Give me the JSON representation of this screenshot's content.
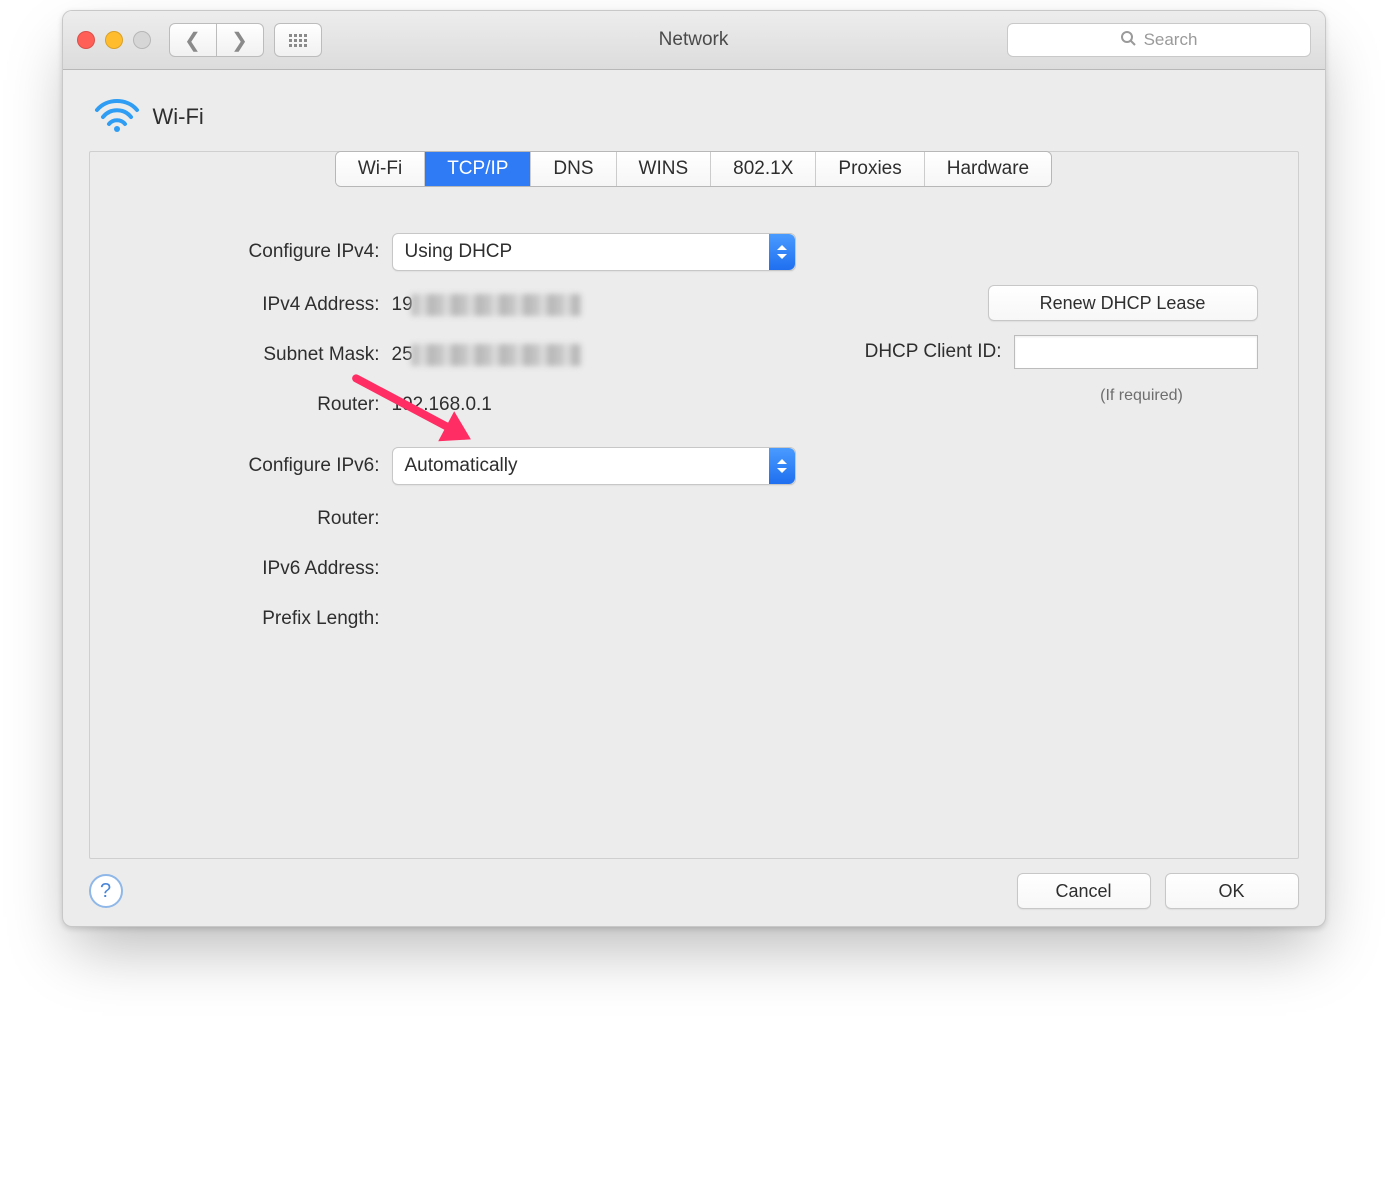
{
  "window": {
    "title": "Network"
  },
  "toolbar": {
    "search_placeholder": "Search"
  },
  "header": {
    "interface_name": "Wi-Fi"
  },
  "tabs": {
    "items": [
      "Wi-Fi",
      "TCP/IP",
      "DNS",
      "WINS",
      "802.1X",
      "Proxies",
      "Hardware"
    ],
    "active_index": 1
  },
  "ipv4": {
    "configure_label": "Configure IPv4:",
    "configure_value": "Using DHCP",
    "address_label": "IPv4 Address:",
    "address_value_visible_prefix": "19",
    "subnet_label": "Subnet Mask:",
    "subnet_value_visible_prefix": "25",
    "router_label": "Router:",
    "router_value": "192.168.0.1"
  },
  "ipv6": {
    "configure_label": "Configure IPv6:",
    "configure_value": "Automatically",
    "router_label": "Router:",
    "router_value": "",
    "address_label": "IPv6 Address:",
    "address_value": "",
    "prefix_label": "Prefix Length:",
    "prefix_value": ""
  },
  "dhcp": {
    "renew_button": "Renew DHCP Lease",
    "client_id_label": "DHCP Client ID:",
    "client_id_value": "",
    "client_id_hint": "(If required)"
  },
  "buttons": {
    "cancel": "Cancel",
    "ok": "OK"
  }
}
